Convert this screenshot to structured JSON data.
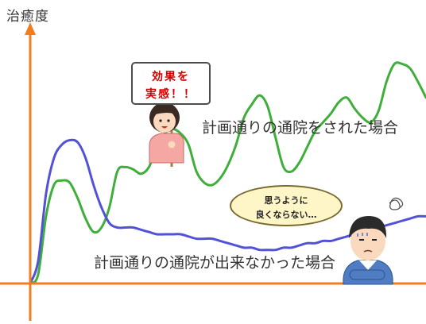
{
  "y_axis_label": "治癒度",
  "colors": {
    "axis": "#f07d1f",
    "planned_curve": "#3fae3a",
    "unplanned_curve": "#5252d8",
    "sign_text": "#d60000",
    "bubble_fill": "#fff6c8"
  },
  "captions": {
    "planned": "計画通りの通院をされた場合",
    "unplanned": "計画通りの通院が出来なかった場合"
  },
  "sign": {
    "line1": "効果を",
    "line2": "実感！！"
  },
  "bubble": {
    "line1": "思うように",
    "line2": "良くならない…"
  },
  "chart_data": {
    "type": "line",
    "title": "",
    "xlabel": "",
    "ylabel": "治癒度",
    "ylim": [
      0,
      100
    ],
    "xlim": [
      0,
      100
    ],
    "grid": false,
    "x": [
      0,
      2,
      4,
      6,
      8,
      10,
      12,
      14,
      16,
      18,
      20,
      22,
      24,
      26,
      28,
      30,
      32,
      34,
      36,
      38,
      40,
      42,
      44,
      46,
      48,
      50,
      52,
      54,
      56,
      58,
      60,
      62,
      64,
      66,
      68,
      70,
      72,
      74,
      76,
      78,
      80,
      82,
      84,
      86,
      88,
      90,
      92,
      94,
      96,
      98,
      100
    ],
    "series": [
      {
        "name": "計画通りの通院をされた場合",
        "values": [
          0,
          4,
          30,
          44,
          46,
          45,
          38,
          29,
          23,
          25,
          34,
          50,
          52,
          51,
          49,
          52,
          61,
          67,
          69,
          67,
          62,
          50,
          45,
          44,
          47,
          53,
          62,
          74,
          80,
          84,
          79,
          65,
          52,
          50,
          54,
          61,
          68,
          72,
          76,
          81,
          83,
          78,
          74,
          72,
          77,
          90,
          98,
          98,
          96,
          90,
          83
        ]
      },
      {
        "name": "計画通りの通院が出来なかった場合",
        "values": [
          0,
          10,
          40,
          56,
          62,
          64,
          63,
          56,
          44,
          34,
          27,
          25,
          25,
          25,
          24,
          23,
          22,
          22,
          22,
          22,
          21,
          20,
          20,
          20,
          19,
          18,
          17,
          16,
          16,
          15,
          15,
          15,
          16,
          16,
          17,
          18,
          18,
          19,
          19,
          20,
          21,
          22,
          23,
          24,
          25,
          26,
          27,
          28,
          29,
          30,
          30
        ]
      }
    ]
  }
}
